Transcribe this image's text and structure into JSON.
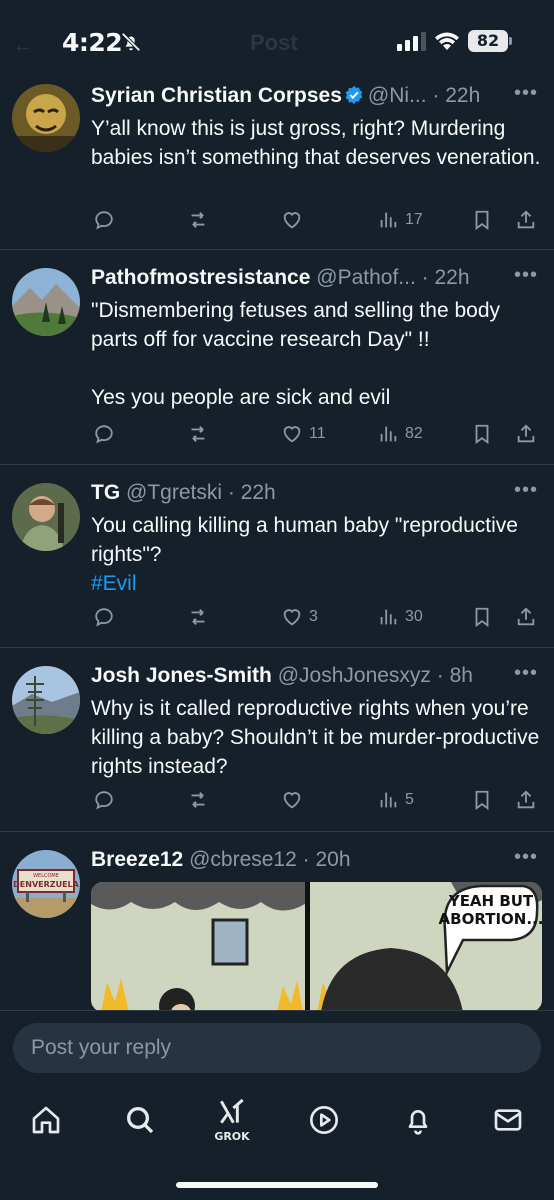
{
  "status_bar": {
    "time": "4:22",
    "battery": "82"
  },
  "header": {
    "back": "←",
    "title": "Post"
  },
  "tweets": [
    {
      "name": "Syrian Christian Corpses",
      "handle": "@Ni...",
      "time": "22h",
      "verified": true,
      "text": "Y’all know this is just gross, right?  Murdering babies isn’t something that deserves veneration.",
      "likes": "",
      "views": "17"
    },
    {
      "name": "Pathofmostresistance",
      "handle": "@Pathof...",
      "time": "22h",
      "text": "\"Dismembering fetuses and selling the body parts off for vaccine research Day\" !!\n\nYes you people are sick and evil",
      "likes": "11",
      "views": "82"
    },
    {
      "name": "TG",
      "handle": "@Tgretski",
      "time": "22h",
      "text": "You calling killing a human baby \"reproductive rights\"?",
      "hashtag": "#Evil",
      "likes": "3",
      "views": "30"
    },
    {
      "name": "Josh Jones-Smith",
      "handle": "@JoshJonesxyz",
      "time": "8h",
      "text": "Why is it called reproductive rights when you’re killing a baby? Shouldn’t it be murder-productive rights instead?",
      "likes": "",
      "views": "5"
    },
    {
      "name": "Breeze12",
      "handle": "@cbrese12",
      "time": "20h",
      "meme_text_line1": "YEAH BUT",
      "meme_text_line2": "ABORTION...",
      "avatar_sign_line1": "WELCOME",
      "avatar_sign_line2": "DENVERZUELA"
    }
  ],
  "reply": {
    "placeholder": "Post your reply"
  },
  "nav": {
    "grok_label": "GROK"
  },
  "colors": {
    "background": "#15202b",
    "secondary_text": "#8b98a5",
    "accent": "#1d9bf0"
  }
}
